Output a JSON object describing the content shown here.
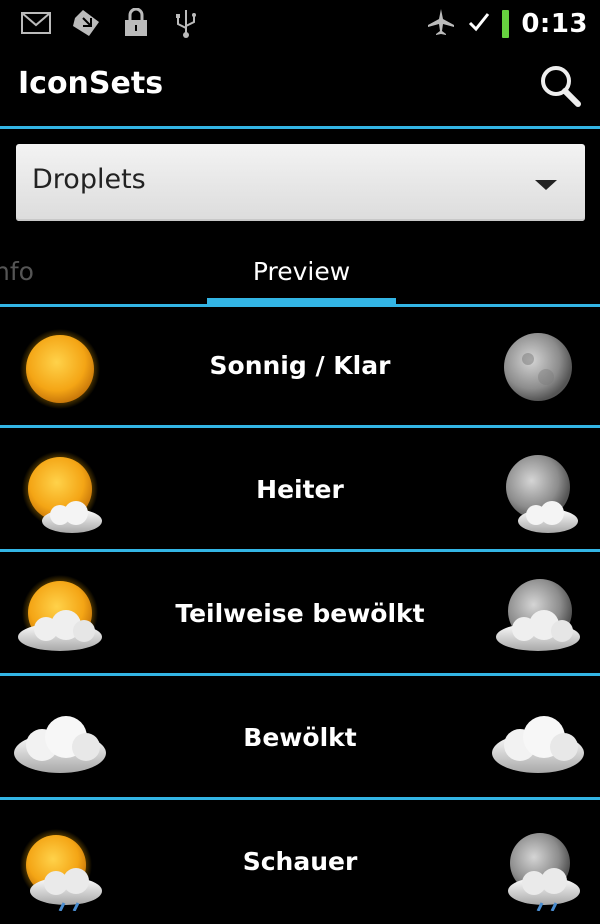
{
  "status_bar": {
    "time": "0:13",
    "icons_left": [
      "gmail-icon",
      "download-icon",
      "lock-icon",
      "usb-icon"
    ],
    "icons_right": [
      "airplane-icon",
      "checkmark-icon",
      "battery-icon"
    ],
    "battery_color": "#66d23f"
  },
  "action_bar": {
    "title": "IconSets",
    "search_icon": "search-icon"
  },
  "spinner": {
    "selected": "Droplets"
  },
  "tabs": [
    {
      "label": "nfo",
      "selected": false
    },
    {
      "label": "Preview",
      "selected": true
    }
  ],
  "conditions": [
    {
      "label": "Sonnig / Klar",
      "day_icon": "sun-icon",
      "night_icon": "moon-icon"
    },
    {
      "label": "Heiter",
      "day_icon": "sun-small-cloud-icon",
      "night_icon": "moon-small-cloud-icon"
    },
    {
      "label": "Teilweise bewölkt",
      "day_icon": "sun-cloud-icon",
      "night_icon": "moon-cloud-icon"
    },
    {
      "label": "Bewölkt",
      "day_icon": "cloud-icon",
      "night_icon": "cloud-icon"
    },
    {
      "label": "Schauer",
      "day_icon": "sun-rain-cloud-icon",
      "night_icon": "moon-rain-cloud-icon"
    }
  ],
  "colors": {
    "accent": "#33b5e5",
    "background": "#000000",
    "spinner_bg": "#e6e6e6",
    "sun": "#f2a51a",
    "moon": "#9a9a9a"
  }
}
